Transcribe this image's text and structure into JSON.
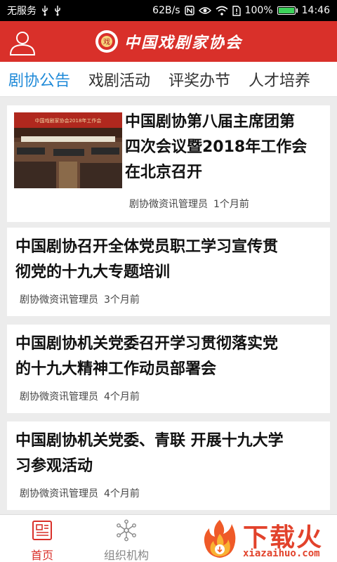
{
  "status_bar": {
    "carrier": "无服务",
    "net_speed": "62B/s",
    "battery_level": "100%",
    "time": "14:46",
    "battery_fraction": 1.0,
    "icons": [
      "usb-icon",
      "usb-icon",
      "nfc-icon",
      "eye-icon",
      "wifi-icon",
      "sim-alert-icon",
      "battery-icon"
    ]
  },
  "header": {
    "brand_name": "中国戏剧家协会",
    "emblem_text": "戏",
    "colors": {
      "background": "#d9302a",
      "text": "#ffffff"
    }
  },
  "tabs": [
    {
      "label": "剧协公告",
      "active": true
    },
    {
      "label": "戏剧活动",
      "active": false
    },
    {
      "label": "评奖办节",
      "active": false
    },
    {
      "label": "人才培养",
      "active": false
    }
  ],
  "news": [
    {
      "title_lines": [
        "中国剧协第八届主席团第",
        "四次会议暨2018年工作会",
        "在北京召开"
      ],
      "author": "剧协微资讯管理员",
      "time": "1个月前",
      "has_image": true,
      "image_caption": "中国戏剧家协会2018年工作会"
    },
    {
      "title_lines": [
        "中国剧协召开全体党员职工学习宣传贯",
        "彻党的十九大专题培训"
      ],
      "author": "剧协微资讯管理员",
      "time": "3个月前",
      "has_image": false
    },
    {
      "title_lines": [
        "中国剧协机关党委召开学习贯彻落实党",
        "的十九大精神工作动员部署会"
      ],
      "author": "剧协微资讯管理员",
      "time": "4个月前",
      "has_image": false
    },
    {
      "title_lines": [
        "中国剧协机关党委、青联 开展十九大学",
        "习参观活动"
      ],
      "author": "剧协微资讯管理员",
      "time": "4个月前",
      "has_image": false
    }
  ],
  "bottom_nav": [
    {
      "label": "首页",
      "icon": "document-icon",
      "active": true
    },
    {
      "label": "组织机构",
      "icon": "network-icon",
      "active": false
    }
  ],
  "watermark": {
    "text": "下载火",
    "url": "xiazaihuo.com"
  }
}
